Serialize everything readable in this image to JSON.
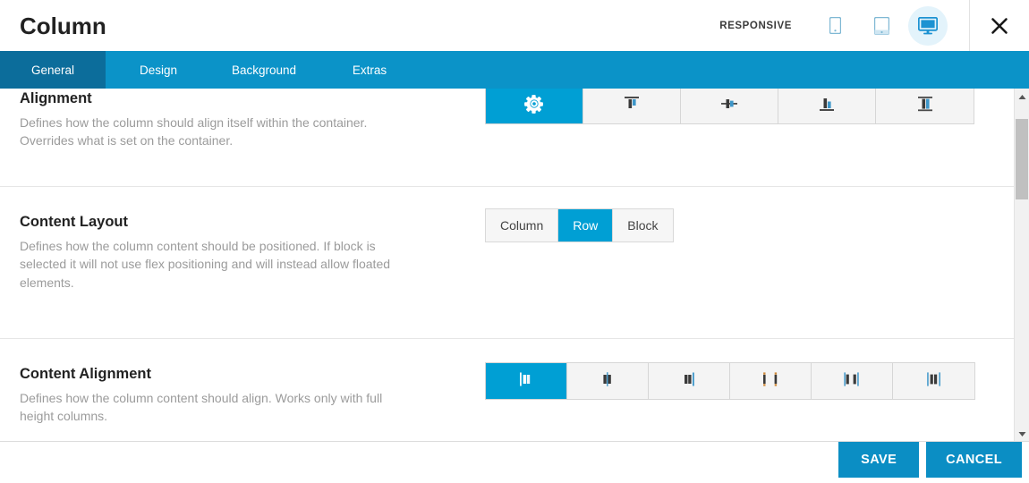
{
  "header": {
    "title": "Column",
    "responsive_label": "RESPONSIVE",
    "devices": [
      {
        "name": "mobile-icon",
        "label": "Mobile",
        "active": false
      },
      {
        "name": "tablet-icon",
        "label": "Tablet",
        "active": false
      },
      {
        "name": "desktop-icon",
        "label": "Desktop",
        "active": true
      }
    ],
    "close_label": "Close"
  },
  "tabs": [
    {
      "label": "General",
      "active": true
    },
    {
      "label": "Design",
      "active": false
    },
    {
      "label": "Background",
      "active": false
    },
    {
      "label": "Extras",
      "active": false
    }
  ],
  "sections": {
    "alignment": {
      "title": "Alignment",
      "desc": "Defines how the column should align itself within the container. Overrides what is set on the container.",
      "options": [
        {
          "name": "alignment-default",
          "icon": "gear-icon",
          "active": true
        },
        {
          "name": "alignment-top",
          "icon": "align-top-icon",
          "active": false
        },
        {
          "name": "alignment-middle",
          "icon": "align-middle-icon",
          "active": false
        },
        {
          "name": "alignment-bottom",
          "icon": "align-bottom-icon",
          "active": false
        },
        {
          "name": "alignment-stretch",
          "icon": "align-stretch-icon",
          "active": false
        }
      ]
    },
    "content_layout": {
      "title": "Content Layout",
      "desc": "Defines how the column content should be positioned. If block is selected it will not use flex positioning and will instead allow floated elements.",
      "options": [
        {
          "label": "Column",
          "active": false
        },
        {
          "label": "Row",
          "active": true
        },
        {
          "label": "Block",
          "active": false
        }
      ]
    },
    "content_alignment": {
      "title": "Content Alignment",
      "desc": "Defines how the column content should align. Works only with full height columns.",
      "options": [
        {
          "name": "content-align-start",
          "icon": "justify-start-icon",
          "active": true
        },
        {
          "name": "content-align-center",
          "icon": "justify-center-icon",
          "active": false
        },
        {
          "name": "content-align-end",
          "icon": "justify-end-icon",
          "active": false
        },
        {
          "name": "content-align-space-between",
          "icon": "justify-space-between-icon",
          "active": false
        },
        {
          "name": "content-align-space-around",
          "icon": "justify-space-around-icon",
          "active": false
        },
        {
          "name": "content-align-space-evenly",
          "icon": "justify-space-evenly-icon",
          "active": false
        }
      ]
    }
  },
  "footer": {
    "save_label": "SAVE",
    "cancel_label": "CANCEL"
  },
  "colors": {
    "accent": "#0b93c8",
    "accent_active_tab": "#0c6d9b",
    "accent_bright": "#009fd4",
    "device_active_bg": "#e3f3fb",
    "text_muted": "#9b9b9b"
  }
}
